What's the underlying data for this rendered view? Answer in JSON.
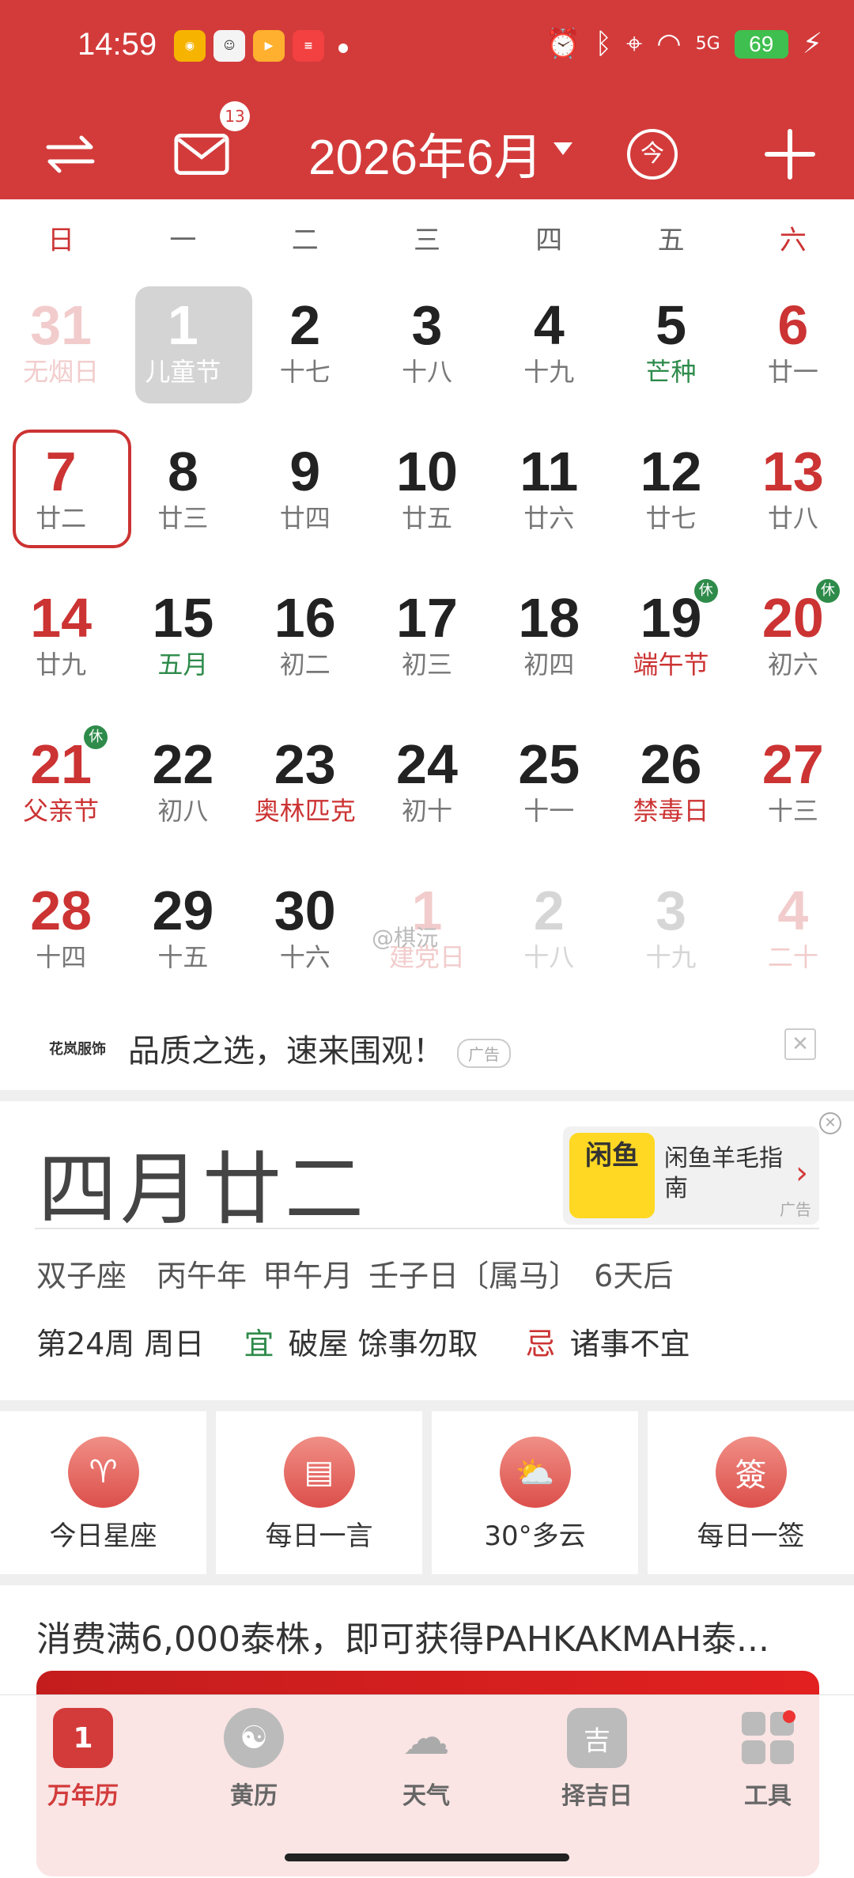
{
  "status_bar": {
    "time": "14:59",
    "battery": "69",
    "network": "5G"
  },
  "header": {
    "month_title": "2026年6月",
    "mail_badge": "13",
    "today_symbol": "今"
  },
  "weekdays": [
    "日",
    "一",
    "二",
    "三",
    "四",
    "五",
    "六"
  ],
  "days": [
    {
      "num": "31",
      "sub": "无烟日",
      "style": "faded"
    },
    {
      "num": "1",
      "sub": "儿童节",
      "style": "today"
    },
    {
      "num": "2",
      "sub": "十七",
      "style": ""
    },
    {
      "num": "3",
      "sub": "十八",
      "style": ""
    },
    {
      "num": "4",
      "sub": "十九",
      "style": ""
    },
    {
      "num": "5",
      "sub": "芒种",
      "style": "greensub"
    },
    {
      "num": "6",
      "sub": "廿一",
      "style": "red"
    },
    {
      "num": "7",
      "sub": "廿二",
      "style": "red sel"
    },
    {
      "num": "8",
      "sub": "廿三",
      "style": ""
    },
    {
      "num": "9",
      "sub": "廿四",
      "style": ""
    },
    {
      "num": "10",
      "sub": "廿五",
      "style": ""
    },
    {
      "num": "11",
      "sub": "廿六",
      "style": ""
    },
    {
      "num": "12",
      "sub": "廿七",
      "style": ""
    },
    {
      "num": "13",
      "sub": "廿八",
      "style": "red"
    },
    {
      "num": "14",
      "sub": "廿九",
      "style": "red"
    },
    {
      "num": "15",
      "sub": "五月",
      "style": "greensub"
    },
    {
      "num": "16",
      "sub": "初二",
      "style": ""
    },
    {
      "num": "17",
      "sub": "初三",
      "style": ""
    },
    {
      "num": "18",
      "sub": "初四",
      "style": ""
    },
    {
      "num": "19",
      "sub": "端午节",
      "style": "redsub",
      "rest": "休"
    },
    {
      "num": "20",
      "sub": "初六",
      "style": "red",
      "rest": "休"
    },
    {
      "num": "21",
      "sub": "父亲节",
      "style": "red redsub",
      "rest": "休"
    },
    {
      "num": "22",
      "sub": "初八",
      "style": ""
    },
    {
      "num": "23",
      "sub": "奥林匹克",
      "style": "redsub"
    },
    {
      "num": "24",
      "sub": "初十",
      "style": ""
    },
    {
      "num": "25",
      "sub": "十一",
      "style": ""
    },
    {
      "num": "26",
      "sub": "禁毒日",
      "style": "redsub"
    },
    {
      "num": "27",
      "sub": "十三",
      "style": "red"
    },
    {
      "num": "28",
      "sub": "十四",
      "style": "red"
    },
    {
      "num": "29",
      "sub": "十五",
      "style": ""
    },
    {
      "num": "30",
      "sub": "十六",
      "style": ""
    },
    {
      "num": "1",
      "sub": "建党日",
      "style": "faded"
    },
    {
      "num": "2",
      "sub": "十八",
      "style": "faded-g"
    },
    {
      "num": "3",
      "sub": "十九",
      "style": "faded-g"
    },
    {
      "num": "4",
      "sub": "二十",
      "style": "faded"
    }
  ],
  "watermark": "@棋沅",
  "ad_bar": {
    "brand": "花岚服饰",
    "text": "品质之选，速来围观！",
    "tag": "广告"
  },
  "detail": {
    "lunar_date": "四月廿二",
    "line1": "双子座　丙午年 甲午月 壬子日〔属马〕　6天后",
    "week": "第24周 周日",
    "yi_label": "宜",
    "yi_text": "破屋 馀事勿取",
    "ji_label": "忌",
    "ji_text": "诸事不宜",
    "side_ad": {
      "logo": "闲鱼",
      "text": "闲鱼羊毛指南",
      "tag": "广告"
    }
  },
  "tiles": [
    {
      "label": "今日星座",
      "glyph": "♈"
    },
    {
      "label": "每日一言",
      "glyph": "▤"
    },
    {
      "label": "30°多云",
      "glyph": "⛅"
    },
    {
      "label": "每日一签",
      "glyph": "簽"
    }
  ],
  "promo": {
    "title": "消费满6,000泰株，即可获得PAHKAKMAH泰..."
  },
  "tabs": [
    {
      "label": "万年历",
      "active": true
    },
    {
      "label": "黄历",
      "active": false
    },
    {
      "label": "天气",
      "active": false
    },
    {
      "label": "择吉日",
      "active": false
    },
    {
      "label": "工具",
      "active": false
    }
  ],
  "colors": {
    "brand_red": "#d33b3b",
    "holiday_green": "#2e8b4a"
  }
}
